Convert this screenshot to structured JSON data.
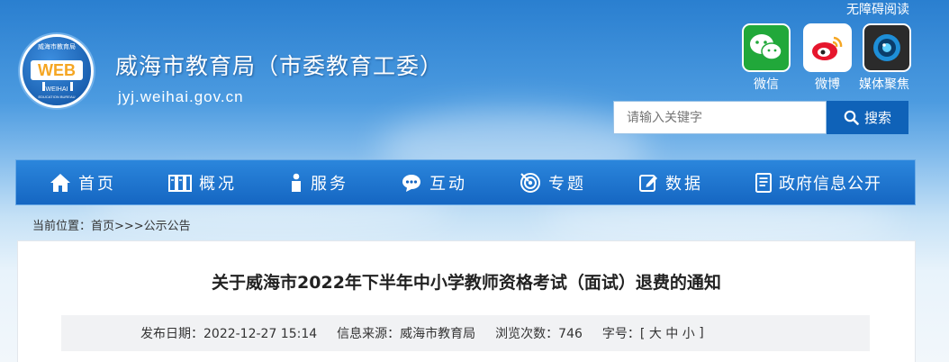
{
  "header": {
    "accessibility_link": "无障碍阅读",
    "site_title": "威海市教育局（市委教育工委）",
    "site_url": "jyj.weihai.gov.cn",
    "logo": {
      "text": "WEB",
      "ring_top": "威海市教育局",
      "ring_bottom": "WEIHAI",
      "ring_bottom_small": "EDUCATION BUREAU"
    },
    "social": [
      {
        "label": "微信",
        "icon": "wechat-icon",
        "color": "#21a83a"
      },
      {
        "label": "微博",
        "icon": "weibo-icon",
        "color": "#e6162d"
      },
      {
        "label": "媒体聚焦",
        "icon": "camera-icon",
        "color": "#2b2b2b"
      }
    ],
    "search": {
      "placeholder": "请输入关键字",
      "button_label": "搜索"
    }
  },
  "nav": {
    "items": [
      {
        "label": "首页",
        "icon": "home-icon"
      },
      {
        "label": "概况",
        "icon": "building-icon"
      },
      {
        "label": "服务",
        "icon": "person-icon"
      },
      {
        "label": "互动",
        "icon": "chat-icon"
      },
      {
        "label": "专题",
        "icon": "target-icon"
      },
      {
        "label": "数据",
        "icon": "edit-icon"
      },
      {
        "label": "政府信息公开",
        "icon": "document-icon"
      }
    ]
  },
  "breadcrumb": {
    "text": "当前位置：首页>>>公示公告"
  },
  "article": {
    "title": "关于威海市2022年下半年中小学教师资格考试（面试）退费的通知",
    "meta": {
      "publish_date": "发布日期：2022-12-27 15:14",
      "source": "信息来源：威海市教育局",
      "views": "浏览次数：746",
      "font_size_label": "字号：[",
      "font_large": "大",
      "font_medium": "中",
      "font_small": "小",
      "font_close": "]"
    }
  },
  "colors": {
    "nav_blue": "#1566c2",
    "search_button": "#0f62b8"
  }
}
